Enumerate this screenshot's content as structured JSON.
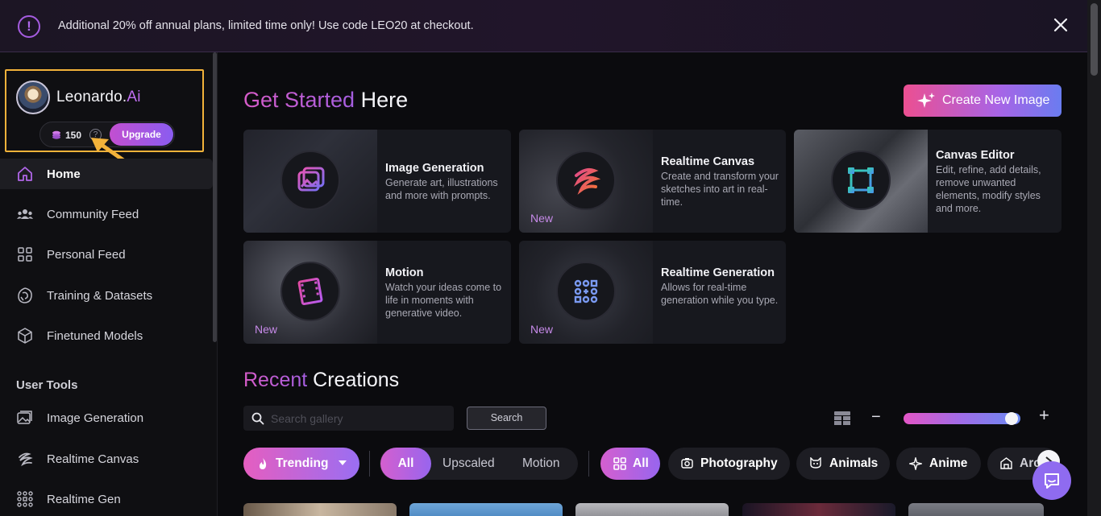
{
  "banner": {
    "text": "Additional 20% off annual plans, limited time only! Use code LEO20 at checkout.",
    "info_icon": "exclamation-circle-icon",
    "close_icon": "close-icon"
  },
  "brand": {
    "name_main": "Leonardo.",
    "name_accent": "Ai",
    "tokens": "150",
    "help": "?",
    "upgrade_label": "Upgrade"
  },
  "sidebar": {
    "items": [
      {
        "label": "Home",
        "icon": "home-icon"
      },
      {
        "label": "Community Feed",
        "icon": "community-icon"
      },
      {
        "label": "Personal Feed",
        "icon": "grid-icon"
      },
      {
        "label": "Training & Datasets",
        "icon": "training-icon"
      },
      {
        "label": "Finetuned Models",
        "icon": "cube-icon"
      }
    ],
    "section_title": "User Tools",
    "tools": [
      {
        "label": "Image Generation",
        "icon": "image-icon"
      },
      {
        "label": "Realtime Canvas",
        "icon": "brush-icon"
      },
      {
        "label": "Realtime Gen",
        "icon": "realtime-gen-icon"
      }
    ]
  },
  "main": {
    "get_started_accent": "Get Started",
    "get_started_rest": "Here",
    "create_label": "Create New Image",
    "cards": [
      {
        "title": "Image Generation",
        "desc": "Generate art, illustrations and more with prompts.",
        "new": ""
      },
      {
        "title": "Realtime Canvas",
        "desc": "Create and transform your sketches into art in real-time.",
        "new": "New"
      },
      {
        "title": "Canvas Editor",
        "desc": "Edit, refine, add details, remove unwanted elements, modify styles and more.",
        "new": ""
      },
      {
        "title": "Motion",
        "desc": "Watch your ideas come to life in moments with generative video.",
        "new": "New"
      },
      {
        "title": "Realtime Generation",
        "desc": "Allows for real-time generation while you type.",
        "new": "New"
      }
    ],
    "recent_accent": "Recent",
    "recent_rest": "Creations",
    "search_placeholder": "Search gallery",
    "search_button": "Search",
    "zoom_level": 0.95,
    "filters": {
      "trending": "Trending",
      "type_options": [
        "All",
        "Upscaled",
        "Motion"
      ],
      "categories": [
        "All",
        "Photography",
        "Animals",
        "Anime",
        "Arc"
      ]
    }
  },
  "colors": {
    "accent_pink": "#e356c6",
    "accent_purple": "#9865ee",
    "highlight_box": "#f2b23a"
  }
}
